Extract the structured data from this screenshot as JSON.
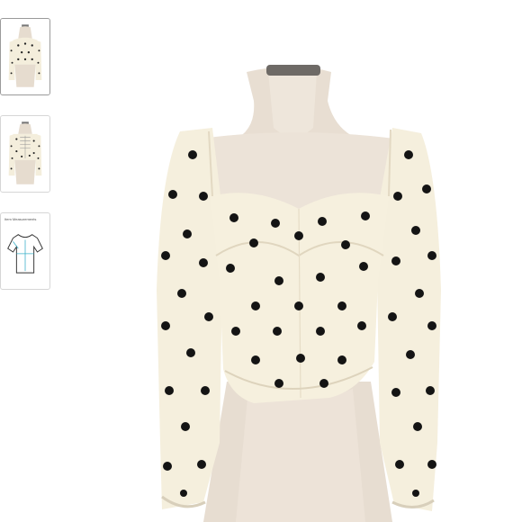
{
  "gallery": {
    "thumbnails": [
      {
        "name": "thumbnail-front-view",
        "selected": true
      },
      {
        "name": "thumbnail-back-view",
        "selected": false
      },
      {
        "name": "thumbnail-size-chart",
        "selected": false,
        "label": "Item Measurements"
      }
    ],
    "main_image": {
      "subject": "cream polka-dot sweetheart-neck long-sleeve crop top on mannequin"
    }
  },
  "colors": {
    "fabric": "#f5efdd",
    "dots": "#141414",
    "mannequin": "#e7ddd1",
    "thumb_border": "#d6d6d6"
  }
}
